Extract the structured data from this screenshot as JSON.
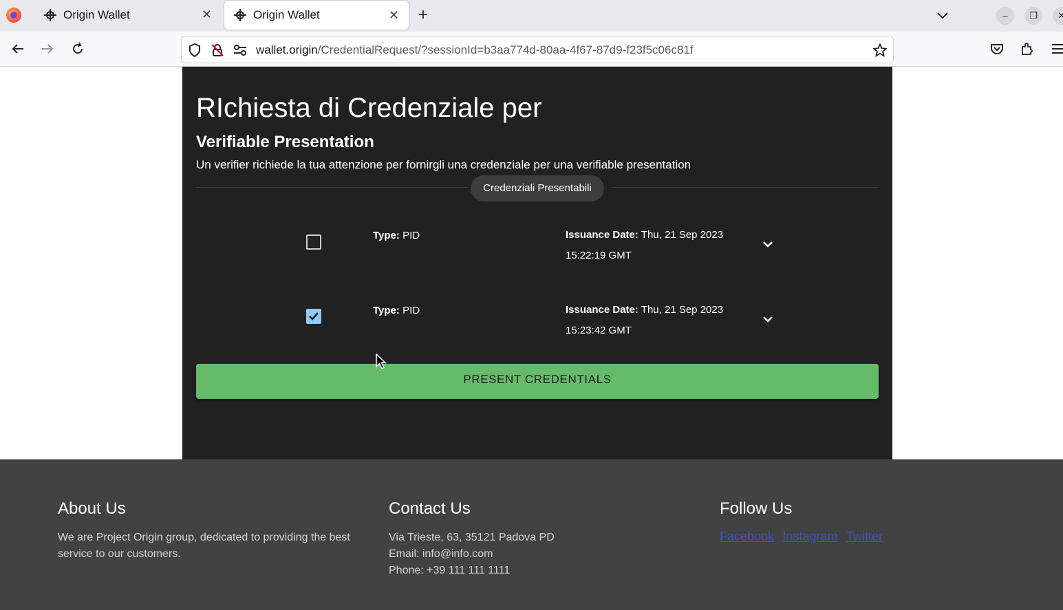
{
  "browser": {
    "tabs": [
      {
        "title": "Origin Wallet",
        "active": false
      },
      {
        "title": "Origin Wallet",
        "active": true
      }
    ],
    "url_domain": "wallet.origin",
    "url_path": "/CredentialRequest/?sessionId=b3aa774d-80aa-4f67-87d9-f23f5c06c81f"
  },
  "page": {
    "title": "RIchiesta di Credenziale per",
    "subtitle": "Verifiable Presentation",
    "description": "Un verifier richiede la tua attenzione per fornirgli una credenziale per una verifiable presentation",
    "section_chip": "Credenziali Presentabili",
    "credentials": [
      {
        "type_label": "Type:",
        "type_value": "PID",
        "issuance_label": "Issuance Date:",
        "issuance_date": "Thu, 21 Sep 2023",
        "issuance_time": "15:22:19 GMT",
        "checked": false
      },
      {
        "type_label": "Type:",
        "type_value": "PID",
        "issuance_label": "Issuance Date:",
        "issuance_date": "Thu, 21 Sep 2023",
        "issuance_time": "15:23:42 GMT",
        "checked": true
      }
    ],
    "present_button": "PRESENT CREDENTIALS"
  },
  "footer": {
    "about": {
      "heading": "About Us",
      "text": "We are Project Origin group, dedicated to providing the best service to our customers."
    },
    "contact": {
      "heading": "Contact Us",
      "address": "Via Trieste, 63, 35121 Padova PD",
      "email": "Email: info@info.com",
      "phone": "Phone: +39 111 111 1111"
    },
    "follow": {
      "heading": "Follow Us",
      "links": [
        "Facebook",
        "Instagram",
        "Twitter"
      ]
    }
  },
  "colors": {
    "card_bg": "#212121",
    "footer_bg": "#424242",
    "button_green": "#66bb6a",
    "checkbox_checked": "#90caf9",
    "link_color": "#3f51b5"
  }
}
